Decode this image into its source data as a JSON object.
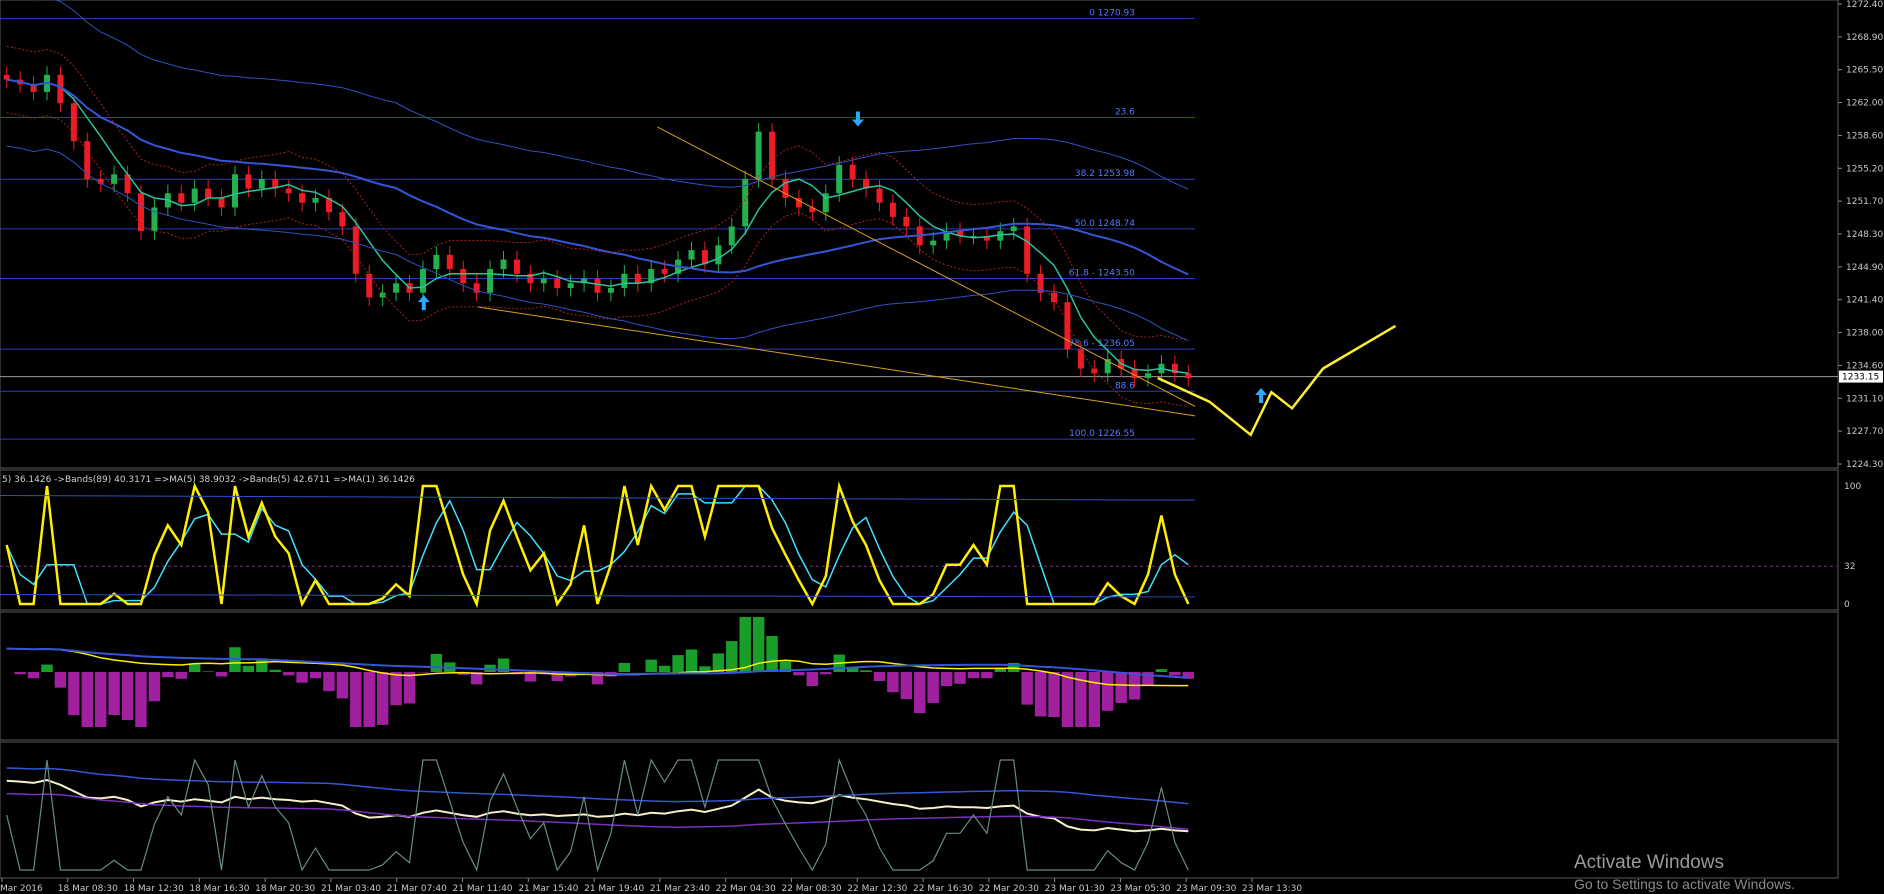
{
  "chart_data": {
    "type": "line",
    "symbol_timeframe": "",
    "price_axis": {
      "ticks": [
        "1272.40",
        "1268.90",
        "1265.50",
        "1262.00",
        "1258.60",
        "1255.20",
        "1251.70",
        "1248.30",
        "1244.90",
        "1241.40",
        "1238.00",
        "1234.60",
        "1231.10",
        "1227.70",
        "1224.30"
      ],
      "current_price": "1233.15"
    },
    "time_axis": {
      "ticks": [
        "Mar 2016",
        "18 Mar 08:30",
        "18 Mar 12:30",
        "18 Mar 16:30",
        "18 Mar 20:30",
        "21 Mar 03:40",
        "21 Mar 07:40",
        "21 Mar 11:40",
        "21 Mar 15:40",
        "21 Mar 19:40",
        "21 Mar 23:40",
        "22 Mar 04:30",
        "22 Mar 08:30",
        "22 Mar 12:30",
        "22 Mar 16:30",
        "22 Mar 20:30",
        "23 Mar 01:30",
        "23 Mar 05:30",
        "23 Mar 09:30",
        "23 Mar 13:30"
      ]
    },
    "fibonacci_levels": [
      {
        "label": "0 1270.93",
        "price": 1270.93
      },
      {
        "label": "23.6",
        "price": 1260.5
      },
      {
        "label": "38.2 1253.98",
        "price": 1253.98
      },
      {
        "label": "50.0 1248.74",
        "price": 1248.74
      },
      {
        "label": "61.8 - 1243.50",
        "price": 1243.5
      },
      {
        "label": "78.6 - 1236.05",
        "price": 1236.05
      },
      {
        "label": "88.6",
        "price": 1231.6
      },
      {
        "label": "100.0 1226.55",
        "price": 1226.55
      }
    ],
    "price_series": [
      1264.5,
      1264.0,
      1263.2,
      1265.0,
      1262.0,
      1258.0,
      1254.0,
      1253.5,
      1254.5,
      1252.5,
      1248.5,
      1251.0,
      1252.5,
      1251.5,
      1253.0,
      1252.0,
      1251.0,
      1254.5,
      1253.0,
      1254.0,
      1253.0,
      1252.5,
      1251.5,
      1252.0,
      1250.5,
      1249.0,
      1244.0,
      1241.5,
      1242.0,
      1243.0,
      1242.0,
      1244.5,
      1246.0,
      1244.5,
      1243.0,
      1242.0,
      1244.5,
      1245.5,
      1244.0,
      1243.0,
      1243.5,
      1242.5,
      1243.0,
      1243.5,
      1242.0,
      1242.5,
      1244.0,
      1243.0,
      1244.5,
      1244.0,
      1245.5,
      1246.5,
      1245.0,
      1247.0,
      1249.0,
      1254.0,
      1259.0,
      1254.0,
      1252.0,
      1251.0,
      1250.5,
      1252.5,
      1255.5,
      1254.0,
      1253.0,
      1251.5,
      1250.0,
      1249.0,
      1247.0,
      1247.5,
      1248.5,
      1248.0,
      1248.0,
      1247.5,
      1248.5,
      1249.0,
      1244.0,
      1242.0,
      1241.0,
      1236.0,
      1234.0,
      1233.5,
      1235.0,
      1234.0,
      1233.0,
      1233.5,
      1234.5,
      1233.5,
      1233.0
    ],
    "trend_lines": [
      {
        "name": "",
        "from": [
          0.4,
          1240.5
        ],
        "to": [
          1.0,
          1229.0
        ]
      },
      {
        "name": "",
        "from": [
          0.55,
          1259.5
        ],
        "to": [
          1.0,
          1230.0
        ]
      }
    ],
    "arrows": {
      "up": [
        [
          0.205,
          1240.8
        ],
        [
          0.61,
          1231.0
        ]
      ],
      "down": [
        [
          0.415,
          1260.5
        ]
      ]
    },
    "projection_path": [
      [
        0.56,
        1233.0
      ],
      [
        0.585,
        1230.5
      ],
      [
        0.605,
        1227.0
      ],
      [
        0.615,
        1231.5
      ],
      [
        0.625,
        1229.8
      ],
      [
        0.64,
        1234.0
      ],
      [
        0.675,
        1238.5
      ]
    ],
    "indicators": [
      {
        "name": "stochastic",
        "legend": "5) 36.1426 ->Bands(89) 40.3171 =>MA(5) 38.9032 ->Bands(5) 42.6711 =>MA(1) 36.1426",
        "ticks": [
          "100",
          "32",
          "0"
        ],
        "level": 32
      },
      {
        "name": "histogram",
        "legend": ""
      },
      {
        "name": "oscillator",
        "legend": ""
      }
    ]
  },
  "colors": {
    "background": "#000000",
    "grid": "#1f1f1f",
    "fib_line": "#2a3db5",
    "up_candle": "#22b14c",
    "down_candle": "#ee1c24",
    "ma_fast": "#28c3a0",
    "ma_slow": "#3456d6",
    "bands": "#3050c0",
    "stoch_main": "#ffee00",
    "stoch_signal": "#40e0ff",
    "histogram_up": "#1a9e2a",
    "histogram_down": "#a020a0",
    "trend_line": "#d8a020",
    "projection": "#ffee33",
    "arrow": "#2ea8ff"
  },
  "watermark": {
    "title": "Activate Windows",
    "subtitle": "Go to Settings to activate Windows."
  }
}
